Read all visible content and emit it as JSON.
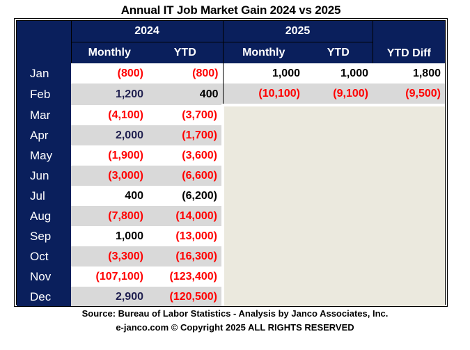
{
  "chart_data": {
    "type": "table",
    "title": "Annual IT  Job Market  Gain 2024 vs 2025",
    "column_groups": [
      {
        "label": "2024",
        "columns": [
          "Monthly",
          "YTD"
        ]
      },
      {
        "label": "2025",
        "columns": [
          "Monthly",
          "YTD"
        ]
      },
      {
        "label": "",
        "columns": [
          "YTD Diff"
        ]
      }
    ],
    "headers": [
      "",
      "Monthly",
      "YTD",
      "Monthly",
      "YTD",
      "YTD Diff"
    ],
    "rows": [
      {
        "month": "Jan",
        "m2024": "(800)",
        "ytd2024": "(800)",
        "m2025": "1,000",
        "ytd2025": "1,000",
        "diff": "1,800"
      },
      {
        "month": "Feb",
        "m2024": "1,200",
        "ytd2024": "400",
        "m2025": "(10,100)",
        "ytd2025": "(9,100)",
        "diff": "(9,500)"
      },
      {
        "month": "Mar",
        "m2024": "(4,100)",
        "ytd2024": "(3,700)",
        "m2025": "",
        "ytd2025": "",
        "diff": ""
      },
      {
        "month": "Apr",
        "m2024": "2,000",
        "ytd2024": "(1,700)",
        "m2025": "",
        "ytd2025": "",
        "diff": ""
      },
      {
        "month": "May",
        "m2024": "(1,900)",
        "ytd2024": "(3,600)",
        "m2025": "",
        "ytd2025": "",
        "diff": ""
      },
      {
        "month": "Jun",
        "m2024": "(3,000)",
        "ytd2024": "(6,600)",
        "m2025": "",
        "ytd2025": "",
        "diff": ""
      },
      {
        "month": "Jul",
        "m2024": "400",
        "ytd2024": "(6,200)",
        "m2025": "",
        "ytd2025": "",
        "diff": ""
      },
      {
        "month": "Aug",
        "m2024": "(7,800)",
        "ytd2024": "(14,000)",
        "m2025": "",
        "ytd2025": "",
        "diff": ""
      },
      {
        "month": "Sep",
        "m2024": "1,000",
        "ytd2024": "(13,000)",
        "m2025": "",
        "ytd2025": "",
        "diff": ""
      },
      {
        "month": "Oct",
        "m2024": "(3,300)",
        "ytd2024": "(16,300)",
        "m2025": "",
        "ytd2025": "",
        "diff": ""
      },
      {
        "month": "Nov",
        "m2024": "(107,100)",
        "ytd2024": "(123,400)",
        "m2025": "",
        "ytd2025": "",
        "diff": ""
      },
      {
        "month": "Dec",
        "m2024": "2,900",
        "ytd2024": "(120,500)",
        "m2025": "",
        "ytd2025": "",
        "diff": ""
      }
    ],
    "values": {
      "2024_monthly": [
        -800,
        1200,
        -4100,
        2000,
        -1900,
        -3000,
        400,
        -7800,
        1000,
        -3300,
        -107100,
        2900
      ],
      "2024_ytd": [
        -800,
        400,
        -3700,
        -1700,
        -3600,
        -6600,
        -6200,
        -14000,
        -13000,
        -16300,
        -123400,
        -120500
      ],
      "2025_monthly": [
        1000,
        -10100
      ],
      "2025_ytd": [
        1000,
        -9100
      ],
      "ytd_diff": [
        1800,
        -9500
      ]
    },
    "text_colors": {
      "2024_ytd_jul": "#000000"
    }
  },
  "title": "Annual IT  Job Market  Gain 2024 vs 2025",
  "header": {
    "year_2024": "2024",
    "year_2025": "2025",
    "monthly": "Monthly",
    "ytd": "YTD",
    "ytd_diff": "YTD Diff"
  },
  "footer": {
    "source": "Source: Bureau of Labor Statistics - Analysis by Janco Associates, Inc.",
    "copyright": "e-janco.com © Copyright 2025 ALL RIGHTS RESERVED"
  },
  "colors": {
    "header_bg": "#0a1f5c",
    "negative": "#ff0000",
    "positive_navy": "#1f1f4f",
    "stripe_gray": "#d9d9d9",
    "empty_area": "#ebe9de"
  }
}
